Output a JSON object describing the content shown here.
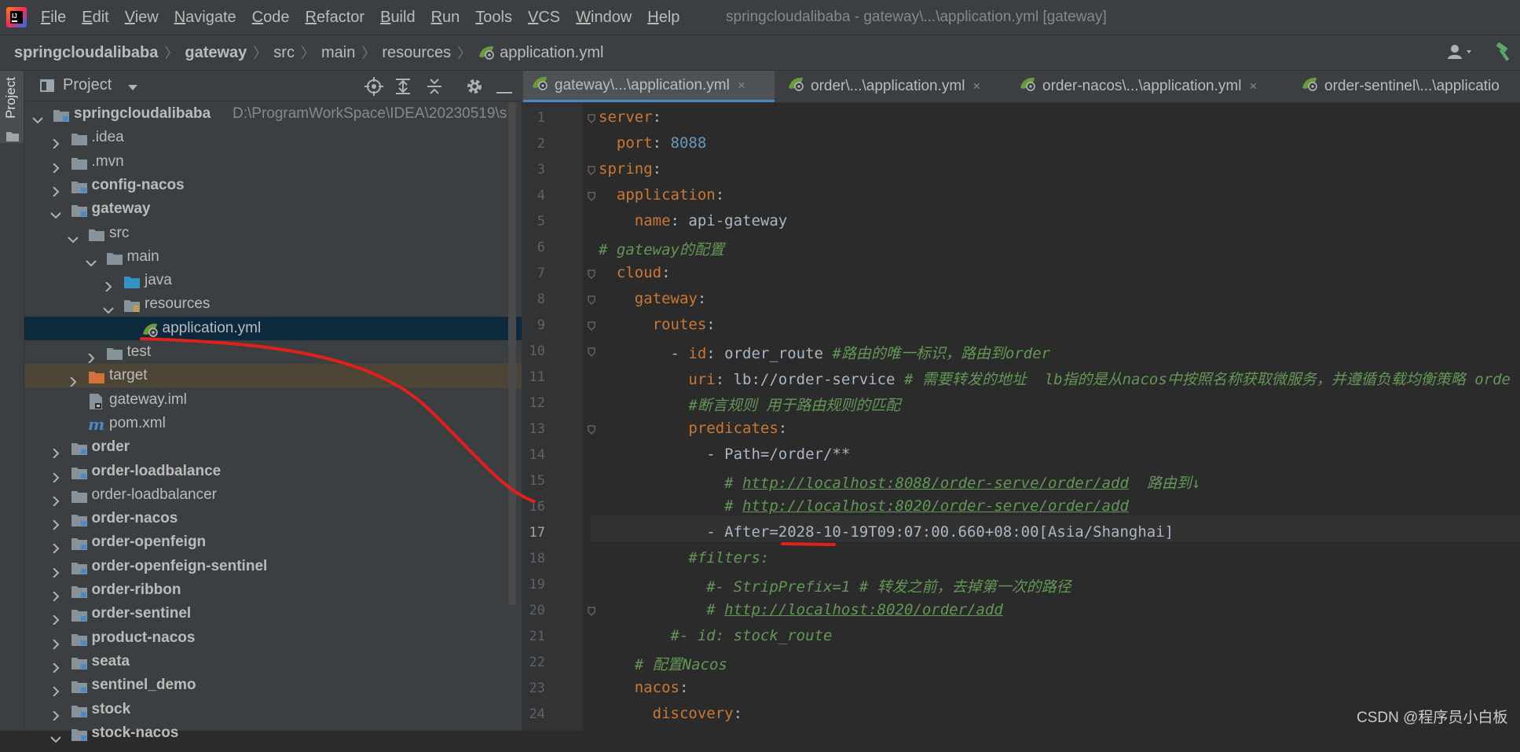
{
  "menu": {
    "items": [
      "File",
      "Edit",
      "View",
      "Navigate",
      "Code",
      "Refactor",
      "Build",
      "Run",
      "Tools",
      "VCS",
      "Window",
      "Help"
    ],
    "window_title": "springcloudalibaba - gateway\\...\\application.yml [gateway]"
  },
  "breadcrumb": [
    "springcloudalibaba",
    "gateway",
    "src",
    "main",
    "resources",
    "application.yml"
  ],
  "sidebar": {
    "strip_tab": "Project"
  },
  "project_panel": {
    "title": "Project",
    "tree": [
      {
        "label": "springcloudalibaba",
        "path": "D:\\ProgramWorkSpace\\IDEA\\20230519\\s",
        "bold": true
      },
      {
        "label": ".idea"
      },
      {
        "label": ".mvn"
      },
      {
        "label": "config-nacos",
        "bold": true
      },
      {
        "label": "gateway",
        "bold": true
      },
      {
        "label": "src"
      },
      {
        "label": "main"
      },
      {
        "label": "java"
      },
      {
        "label": "resources"
      },
      {
        "label": "application.yml"
      },
      {
        "label": "test"
      },
      {
        "label": "target"
      },
      {
        "label": "gateway.iml"
      },
      {
        "label": "pom.xml"
      },
      {
        "label": "order",
        "bold": true
      },
      {
        "label": "order-loadbalance",
        "bold": true
      },
      {
        "label": "order-loadbalancer"
      },
      {
        "label": "order-nacos",
        "bold": true
      },
      {
        "label": "order-openfeign",
        "bold": true
      },
      {
        "label": "order-openfeign-sentinel",
        "bold": true
      },
      {
        "label": "order-ribbon",
        "bold": true
      },
      {
        "label": "order-sentinel",
        "bold": true
      },
      {
        "label": "product-nacos",
        "bold": true
      },
      {
        "label": "seata",
        "bold": true
      },
      {
        "label": "sentinel_demo",
        "bold": true
      },
      {
        "label": "stock",
        "bold": true
      },
      {
        "label": "stock-nacos",
        "bold": true
      }
    ]
  },
  "editor": {
    "tabs": [
      {
        "label": "gateway\\...\\application.yml",
        "active": true
      },
      {
        "label": "order\\...\\application.yml"
      },
      {
        "label": "order-nacos\\...\\application.yml"
      },
      {
        "label": "order-sentinel\\...\\applicatio"
      }
    ],
    "close_glyph": "×",
    "current_line": 17,
    "lines": [
      {
        "n": "1",
        "parts": [
          [
            "k",
            "server"
          ],
          [
            "p",
            ":"
          ]
        ]
      },
      {
        "n": "2",
        "parts": [
          [
            "p",
            "  "
          ],
          [
            "k",
            "port"
          ],
          [
            "p",
            ": "
          ],
          [
            "n",
            "8088"
          ]
        ]
      },
      {
        "n": "3",
        "parts": [
          [
            "k",
            "spring"
          ],
          [
            "p",
            ":"
          ]
        ]
      },
      {
        "n": "4",
        "parts": [
          [
            "p",
            "  "
          ],
          [
            "k",
            "application"
          ],
          [
            "p",
            ":"
          ]
        ]
      },
      {
        "n": "5",
        "parts": [
          [
            "p",
            "    "
          ],
          [
            "k",
            "name"
          ],
          [
            "p",
            ": api-gateway"
          ]
        ]
      },
      {
        "n": "6",
        "parts": [
          [
            "c",
            "# gateway的配置"
          ]
        ]
      },
      {
        "n": "7",
        "parts": [
          [
            "p",
            "  "
          ],
          [
            "k",
            "cloud"
          ],
          [
            "p",
            ":"
          ]
        ]
      },
      {
        "n": "8",
        "parts": [
          [
            "p",
            "    "
          ],
          [
            "k",
            "gateway"
          ],
          [
            "p",
            ":"
          ]
        ]
      },
      {
        "n": "9",
        "parts": [
          [
            "p",
            "      "
          ],
          [
            "k",
            "routes"
          ],
          [
            "p",
            ":"
          ]
        ]
      },
      {
        "n": "10",
        "parts": [
          [
            "p",
            "        - "
          ],
          [
            "k",
            "id"
          ],
          [
            "p",
            ": order_route "
          ],
          [
            "c",
            "#路由的唯一标识，路由到order"
          ]
        ]
      },
      {
        "n": "11",
        "parts": [
          [
            "p",
            "          "
          ],
          [
            "k",
            "uri"
          ],
          [
            "p",
            ": lb://order-service "
          ],
          [
            "c",
            "# 需要转发的地址  lb指的是从nacos中按照名称获取微服务，并遵循负载均衡策略 orde"
          ]
        ]
      },
      {
        "n": "12",
        "parts": [
          [
            "p",
            "          "
          ],
          [
            "c",
            "#断言规则 用于路由规则的匹配"
          ]
        ]
      },
      {
        "n": "13",
        "parts": [
          [
            "p",
            "          "
          ],
          [
            "k",
            "predicates"
          ],
          [
            "p",
            ":"
          ]
        ]
      },
      {
        "n": "14",
        "parts": [
          [
            "p",
            "            - Path=/order/**"
          ]
        ]
      },
      {
        "n": "15",
        "parts": [
          [
            "p",
            "              "
          ],
          [
            "c",
            "# "
          ],
          [
            "a",
            "http://localhost:8088/order-serve/order/add"
          ],
          [
            "c",
            "  路由到↓"
          ]
        ]
      },
      {
        "n": "16",
        "parts": [
          [
            "p",
            "              "
          ],
          [
            "c",
            "# "
          ],
          [
            "a",
            "http://localhost:8020/order-serve/order/add"
          ]
        ]
      },
      {
        "n": "17",
        "parts": [
          [
            "p",
            "            - After=2028-10-19T09:07:00.660+08:00[Asia/Shanghai]"
          ]
        ]
      },
      {
        "n": "18",
        "parts": [
          [
            "p",
            "          "
          ],
          [
            "c",
            "#filters:"
          ]
        ]
      },
      {
        "n": "19",
        "parts": [
          [
            "p",
            "            "
          ],
          [
            "c",
            "#- StripPrefix=1 # 转发之前，去掉第一次的路径"
          ]
        ]
      },
      {
        "n": "20",
        "parts": [
          [
            "p",
            "            "
          ],
          [
            "c",
            "# "
          ],
          [
            "a",
            "http://localhost:8020/order/add"
          ]
        ]
      },
      {
        "n": "21",
        "parts": [
          [
            "p",
            "        "
          ],
          [
            "c",
            "#- id: stock_route"
          ]
        ]
      },
      {
        "n": "22",
        "parts": [
          [
            "p",
            "    "
          ],
          [
            "c",
            "# 配置Nacos"
          ]
        ]
      },
      {
        "n": "23",
        "parts": [
          [
            "p",
            "    "
          ],
          [
            "k",
            "nacos"
          ],
          [
            "p",
            ":"
          ]
        ]
      },
      {
        "n": "24",
        "parts": [
          [
            "p",
            "      "
          ],
          [
            "k",
            "discovery"
          ],
          [
            "p",
            ":"
          ]
        ]
      }
    ]
  },
  "watermark": "CSDN @程序员小白板",
  "colors": {
    "background": "#2b2b2b",
    "panel": "#3c3f41",
    "keyword": "#cc7832",
    "number": "#6897bb",
    "comment": "#629755",
    "text": "#a9b7c6",
    "selection": "#0d293e",
    "annotation": "#e0201a"
  }
}
